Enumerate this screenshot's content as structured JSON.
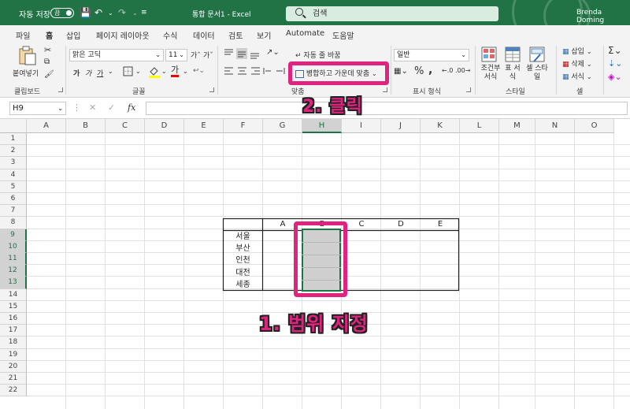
{
  "titlebar": {
    "autosave_label": "자동 저장",
    "autosave_state": "끔",
    "doc_title": "통합 문서1 - Excel",
    "search_placeholder": "검색",
    "user_name": "Brenda Doming"
  },
  "menu": {
    "tabs": [
      "파일",
      "홈",
      "삽입",
      "페이지 레이아웃",
      "수식",
      "데이터",
      "검토",
      "보기",
      "Automate",
      "도움말"
    ],
    "active": "홈"
  },
  "ribbon": {
    "clipboard": {
      "paste_label": "붙여넣기",
      "group_label": "클립보드"
    },
    "font": {
      "font_name": "맑은 고딕",
      "font_size": "11",
      "group_label": "글꼴",
      "bold": "가",
      "italic": "가",
      "underline": "가"
    },
    "alignment": {
      "wrap_text": "자동 줄 바꿈",
      "merge_center": "병합하고 가운데 맞춤",
      "group_label": "맞춤"
    },
    "number": {
      "format": "일반",
      "group_label": "표시 형식"
    },
    "styles": {
      "conditional": "조건부 서식",
      "table": "표 서식",
      "cell": "셀 스타일",
      "group_label": "스타일"
    },
    "cells": {
      "insert": "삽입",
      "delete": "삭제",
      "format": "서식",
      "group_label": "셀"
    }
  },
  "formula_bar": {
    "name_box": "H9",
    "fx": "fx",
    "content": ""
  },
  "grid": {
    "columns": [
      "A",
      "B",
      "C",
      "D",
      "E",
      "F",
      "G",
      "H",
      "I",
      "J",
      "K",
      "L",
      "M",
      "N",
      "O"
    ],
    "rows": [
      "1",
      "2",
      "3",
      "4",
      "5",
      "6",
      "7",
      "8",
      "9",
      "10",
      "11",
      "12",
      "13",
      "14",
      "15",
      "16",
      "17",
      "18",
      "19",
      "20",
      "21",
      "22"
    ],
    "selected_column": "H",
    "selected_rows": [
      "9",
      "10",
      "11",
      "12",
      "13"
    ]
  },
  "table": {
    "headers": [
      "A",
      "B",
      "C",
      "D",
      "E"
    ],
    "row_labels": [
      "서울",
      "부산",
      "인천",
      "대전",
      "세종"
    ]
  },
  "annotations": {
    "step1": "1. 범위 지정",
    "step2": "2. 클릭"
  },
  "colors": {
    "excel_green": "#217346",
    "highlight": "#e0237e"
  }
}
